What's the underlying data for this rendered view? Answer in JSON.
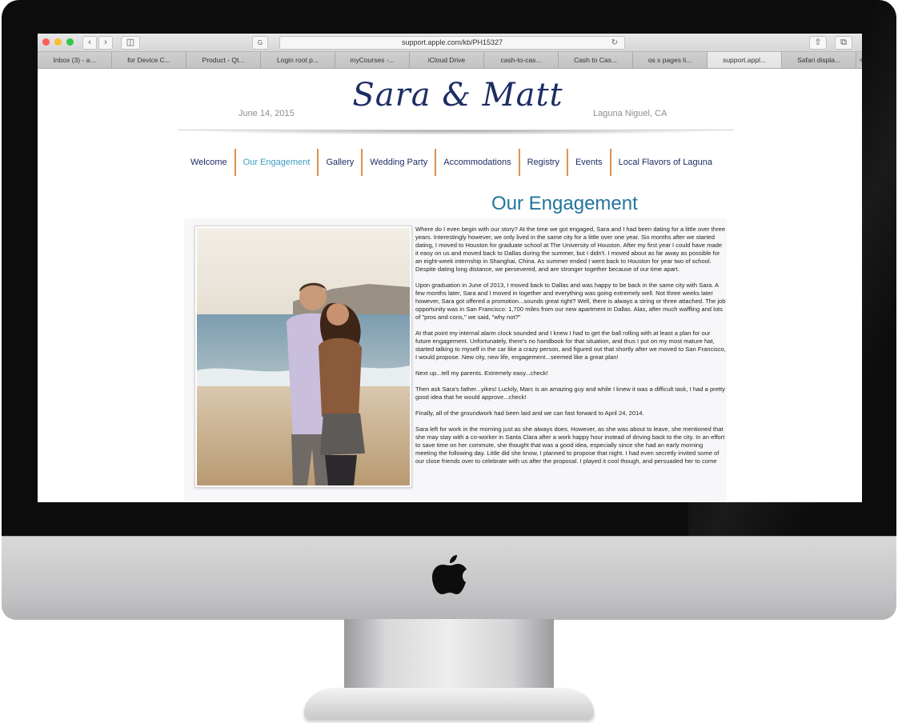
{
  "browser": {
    "url": "support.apple.com/kb/PH15327",
    "tabs": [
      {
        "label": "Inbox (3) - a...",
        "active": false
      },
      {
        "label": "for Device C...",
        "active": false
      },
      {
        "label": "Product - Qt...",
        "active": false
      },
      {
        "label": "Login root p...",
        "active": false
      },
      {
        "label": "myCourses -...",
        "active": false
      },
      {
        "label": "iCloud Drive",
        "active": false
      },
      {
        "label": "cash-to-cas...",
        "active": false
      },
      {
        "label": "Cash to Cas...",
        "active": false
      },
      {
        "label": "os x pages li...",
        "active": false
      },
      {
        "label": "support.appl...",
        "active": true
      },
      {
        "label": "Safari displa...",
        "active": false
      }
    ]
  },
  "header": {
    "date": "June 14, 2015",
    "title": "Sara & Matt",
    "location": "Laguna Niguel, CA"
  },
  "nav": [
    {
      "label": "Welcome",
      "active": false
    },
    {
      "label": "Our Engagement",
      "active": true
    },
    {
      "label": "Gallery",
      "active": false
    },
    {
      "label": "Wedding Party",
      "active": false
    },
    {
      "label": "Accommodations",
      "active": false
    },
    {
      "label": "Registry",
      "active": false
    },
    {
      "label": "Events",
      "active": false
    },
    {
      "label": "Local Flavors of Laguna",
      "active": false
    }
  ],
  "section": {
    "title": "Our Engagement",
    "paragraphs": [
      "Where do I even begin with our story? At the time we got engaged, Sara and I had been dating for a little over three years. Interestingly however, we only lived in the same city for a little over one year. Six months after we started dating, I moved to Houston for graduate school at The University of Houston. After my first year I could have made it easy on us and moved back to Dallas during the summer, but I didn't. I moved about as far away as possible for an eight-week internship in Shanghai, China. As summer ended I went back to Houston for year two of school. Despite dating long distance, we persevered, and are stronger together because of our time apart.",
      "Upon graduation in June of 2013, I moved back to Dallas and was happy to be back in the same city with Sara. A few months later, Sara and I moved in together and everything was going extremely well. Not three weeks later however, Sara got offered a promotion...sounds great right? Well, there is always a string or three attached. The job opportunity was in San Francisco: 1,700 miles from our new apartment in Dallas. Alas, after much waffling and lots of \"pros and cons,\" we said, \"why not?\"",
      "At that point my internal alarm clock sounded and I knew I had to get the ball rolling with at least a plan for our future engagement. Unfortunately, there's no handbook for that situation, and thus I put on my most mature hat, started talking to myself in the car like a crazy person, and figured out that shortly after we moved to San Francisco, I would propose. New city, new life, engagement...seemed like a great plan!",
      "Next up...tell my parents. Extremely easy...check!",
      "Then ask Sara's father...yikes! Luckily, Marc is an amazing guy and while I knew it was a difficult task, I had a pretty good idea that he would approve...check!",
      "Finally, all of the groundwork had been laid and we can fast forward to April 24, 2014.",
      "Sara left for work in the morning just as she always does. However, as she was about to leave, she mentioned that she may stay with a co-worker in Santa Clara after a work happy hour instead of driving back to the city. In an effort to save time on her commute, she thought that was a good idea, especially since she had an early morning meeting the following day. Little did she know, I planned to propose that night. I had even secretly invited some of our close friends over to celebrate with us after the proposal. I played it cool though, and persuaded her to come"
    ]
  }
}
